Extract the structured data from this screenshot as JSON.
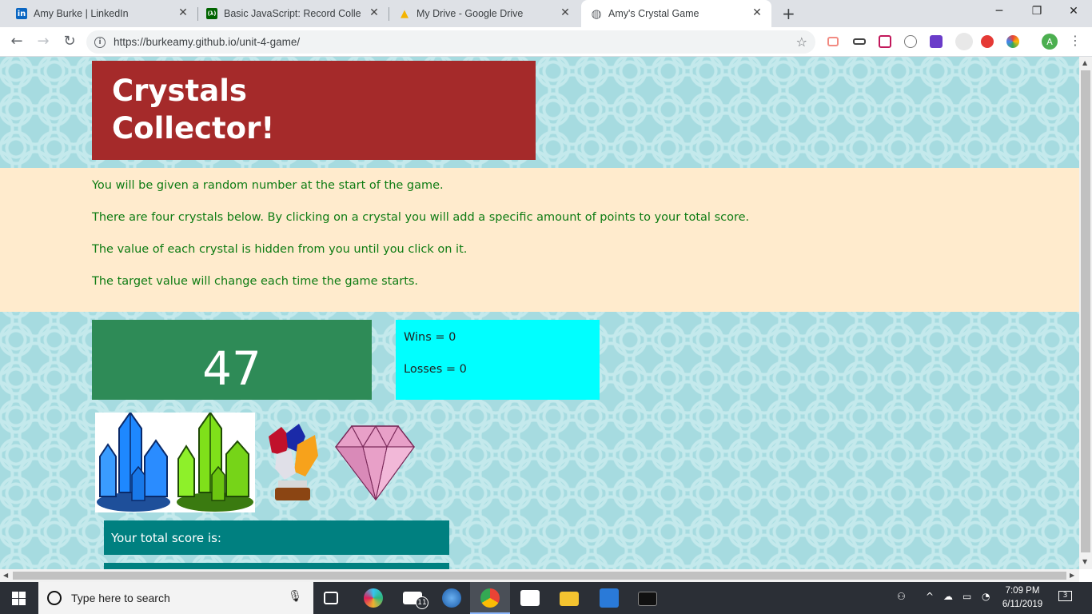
{
  "browser": {
    "tabs": [
      {
        "title": "Amy Burke | LinkedIn",
        "icon": "linkedin-icon",
        "color": "#0a66c2",
        "glyph": "in"
      },
      {
        "title": "Basic JavaScript: Record Collectio",
        "icon": "freecodecamp-icon",
        "color": "#006400",
        "glyph": "(λ)"
      },
      {
        "title": "My Drive - Google Drive",
        "icon": "google-drive-icon",
        "color": "#f4b400",
        "glyph": "▲"
      },
      {
        "title": "Amy's Crystal Game",
        "icon": "globe-icon",
        "color": "#5f6368",
        "glyph": "◍"
      }
    ],
    "close_glyph": "✕",
    "new_tab_glyph": "+",
    "url": "https://burkeamy.github.io/unit-4-game/",
    "window_controls": {
      "minimize": "─",
      "maximize": "❐",
      "close": "✕"
    },
    "profile_initial": "A"
  },
  "game": {
    "title": "Crystals Collector!",
    "instructions": [
      "You will be given a random number at the start of the game.",
      "There are four crystals below. By clicking on a crystal you will add a specific amount of points to your total score.",
      "The value of each crystal is hidden from you until you click on it.",
      "The target value will change each time the game starts."
    ],
    "target_number": "47",
    "wins_label": "Wins = 0",
    "losses_label": "Losses = 0",
    "score_label": "Your total score is:",
    "colors": {
      "title_bg": "#a52a2a",
      "instructions_bg": "#ffebcd",
      "text_green": "#0f7c14",
      "target_bg": "#2e8b57",
      "record_bg": "#00ffff",
      "score_bg": "#008080"
    }
  },
  "taskbar": {
    "search_placeholder": "Type here to search",
    "mail_badge": "11",
    "time": "7:09 PM",
    "date": "6/11/2019",
    "notification_count": "3"
  }
}
